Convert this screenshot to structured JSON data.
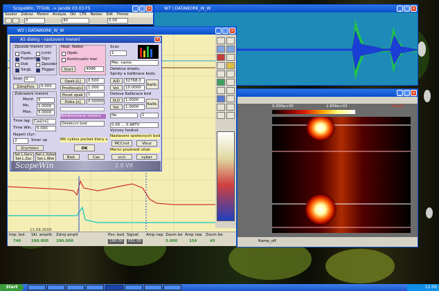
{
  "windows": {
    "main": {
      "title": "ScopeWin, TT508, -> Jandik 03.03.F5"
    },
    "dataworkTop": {
      "title": "W7 \\ DATAWORK_W_W"
    },
    "dataworkMid": {
      "title": "W3 \\ DATAWORK_W_W"
    },
    "bottomStatusLabel": "Ramp_off"
  },
  "mainMenu": [
    "Soubor",
    "Zobraz",
    "Mereni",
    "Analyza",
    "Okl",
    "CFR",
    "Nastav",
    "Edit",
    "Prenos"
  ],
  "mainToolbar": {
    "field1": "0",
    "field2": "40",
    "field3": "0.00"
  },
  "dialog": {
    "title": "A5 dialog - nastaveni mereni",
    "left": {
      "groupLabel": "Zpusob mereni (zn)",
      "opts": [
        {
          "label": "Opak.",
          "checked": false
        },
        {
          "label": "Limit",
          "checked": false
        },
        {
          "label": "Fopkonfly",
          "checked": true
        },
        {
          "label": "Sign",
          "checked": true
        },
        {
          "label": "Dok",
          "checked": false
        },
        {
          "label": "Zpozdeni",
          "checked": false
        },
        {
          "label": "SingL",
          "checked": true
        },
        {
          "label": "Trigger",
          "checked": true
        }
      ],
      "scanLabel": "Scan",
      "scanValue": "0",
      "zdrojPuls": "ZdrojPuls",
      "zdrojValue": "5.000",
      "section2": "Zobrazeni mereni",
      "rows": [
        {
          "label": "Monit",
          "value": "5"
        },
        {
          "label": "Mn.",
          "value": "1.0000"
        },
        {
          "label": "Max.",
          "value": "5.0000"
        }
      ],
      "timeLabel": "Time lag:",
      "timeValue": "Cas[ns]",
      "timeWLabel": "Time Win.",
      "timeWValue": "5.000",
      "section3": "Napeti ctyr:",
      "selValue": "2",
      "selLabel": "Smer up",
      "zrychleni": "Zrychleni",
      "saveButtons": [
        {
          "line1": "Set.L.Konc",
          "line2": "Set.L.Zac"
        },
        {
          "line1": "Set.L.Vyber",
          "line2": "Set.L.Wok"
        }
      ]
    },
    "mid": {
      "groupLabel": "Nepl. Nabor",
      "checks": [
        {
          "label": "Opak.",
          "checked": false
        },
        {
          "label": "Kontinualni mer",
          "checked": false
        }
      ],
      "startLabel": "Start",
      "startValue": "4096",
      "rows": [
        {
          "label": "Opak.[L]",
          "value": "0.500"
        },
        {
          "label": "Prodleva[s]",
          "value": "1.000"
        },
        {
          "label": "Pocet opak",
          "value": "1"
        },
        {
          "label": "Doba [s]",
          "value": "0.000000"
        }
      ],
      "modeLabel": "Kombinovane mereni",
      "modeValue": "Detekcni bod",
      "tail": "Mit cyklus pocket ktery se posunji",
      "okLabel": "OK",
      "kbdLabel": "Bed.",
      "cancelLabel": "Cas"
    },
    "right": {
      "scanLabel": "Scan",
      "scanValue": "1",
      "nameLabel": "Mer. name",
      "sectionA": "Detekce stredu",
      "sectionAsub": "Spicky a kalibrace bodu",
      "apdLabel": "A/D",
      "apdValue": "32768.0",
      "volLabel": "Vol.",
      "volValue": "10.0000",
      "kalibLabel": "Kalib.",
      "sectionB": "Datova Kalibrace bod",
      "ndLabel": "N.D",
      "ndValue": "1.0000",
      "vol2Label": "Vol.",
      "vol2Value": "1.0000",
      "noLabel": "Ne",
      "noValue": "1",
      "rateValue": "0.00 ... 0.98TV",
      "rateLabel": "Vynosy hodnot",
      "sectionC": "Nastaveni spolecnych bodu",
      "btn1": "MCCnvt",
      "btn2": "Vbuz",
      "scopeLabel": "Merici prostredi vitali",
      "vcLabel": "vc/c",
      "vyberLabel": "vyber"
    }
  },
  "brand": {
    "text": "ScopeWin",
    "sub": "2.0 VX"
  },
  "statusBar": {
    "labels": [
      "Imp. bol.",
      "Skl. amplitudu",
      "Zdroj amplitudu",
      "",
      "Pov. bod",
      "Signal",
      "Amp nepr.",
      "Zoom bod",
      "Amp nepr.",
      "Zoom bod"
    ],
    "values": [
      "740",
      "290.000",
      "290.000",
      "",
      "190.00",
      "051.00",
      "5.000",
      "",
      "154",
      "45"
    ]
  },
  "timeStamp": "11.09.2003",
  "heatmap": {
    "minLabel": "0.000e+00",
    "maxLabel": "2.856e+02",
    "unitLabel": "Amplit"
  },
  "taskbar": {
    "start": "Start",
    "tasks": [
      {
        "label": ""
      },
      {
        "label": ""
      },
      {
        "label": ""
      },
      {
        "label": ""
      },
      {
        "label": ""
      },
      {
        "label": ""
      },
      {
        "label": ""
      },
      {
        "label": ""
      }
    ],
    "clock": "12:00"
  }
}
